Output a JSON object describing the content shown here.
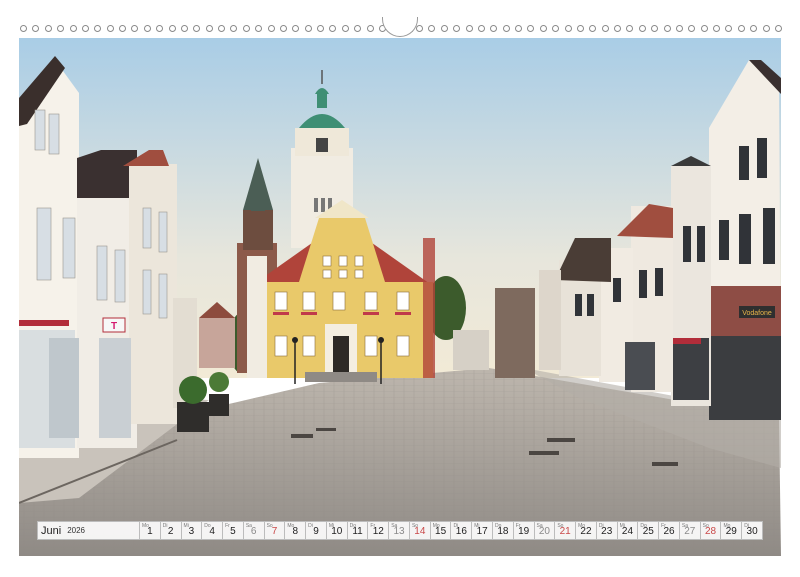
{
  "calendar": {
    "month": "Juni",
    "year": "2026",
    "days": [
      {
        "n": "1",
        "dow": "Mo",
        "t": "wd"
      },
      {
        "n": "2",
        "dow": "Di",
        "t": "wd"
      },
      {
        "n": "3",
        "dow": "Mi",
        "t": "wd"
      },
      {
        "n": "4",
        "dow": "Do",
        "t": "wd"
      },
      {
        "n": "5",
        "dow": "Fr",
        "t": "wd"
      },
      {
        "n": "6",
        "dow": "Sa",
        "t": "sat"
      },
      {
        "n": "7",
        "dow": "So",
        "t": "sun"
      },
      {
        "n": "8",
        "dow": "Mo",
        "t": "wd"
      },
      {
        "n": "9",
        "dow": "Di",
        "t": "wd"
      },
      {
        "n": "10",
        "dow": "Mi",
        "t": "wd"
      },
      {
        "n": "11",
        "dow": "Do",
        "t": "wd"
      },
      {
        "n": "12",
        "dow": "Fr",
        "t": "wd"
      },
      {
        "n": "13",
        "dow": "Sa",
        "t": "sat"
      },
      {
        "n": "14",
        "dow": "So",
        "t": "sun"
      },
      {
        "n": "15",
        "dow": "Mo",
        "t": "wd"
      },
      {
        "n": "16",
        "dow": "Di",
        "t": "wd"
      },
      {
        "n": "17",
        "dow": "Mi",
        "t": "wd"
      },
      {
        "n": "18",
        "dow": "Do",
        "t": "wd"
      },
      {
        "n": "19",
        "dow": "Fr",
        "t": "wd"
      },
      {
        "n": "20",
        "dow": "Sa",
        "t": "sat"
      },
      {
        "n": "21",
        "dow": "So",
        "t": "sun"
      },
      {
        "n": "22",
        "dow": "Mo",
        "t": "wd"
      },
      {
        "n": "23",
        "dow": "Di",
        "t": "wd"
      },
      {
        "n": "24",
        "dow": "Mi",
        "t": "wd"
      },
      {
        "n": "25",
        "dow": "Do",
        "t": "wd"
      },
      {
        "n": "26",
        "dow": "Fr",
        "t": "wd"
      },
      {
        "n": "27",
        "dow": "Sa",
        "t": "sat"
      },
      {
        "n": "28",
        "dow": "So",
        "t": "sun"
      },
      {
        "n": "29",
        "dow": "Mo",
        "t": "wd"
      },
      {
        "n": "30",
        "dow": "Di",
        "t": "wd"
      }
    ]
  },
  "signs": {
    "shop_left": "T",
    "shop_right": "Vodafone"
  },
  "colors": {
    "sky_top": "#a9cde6",
    "sky_bottom": "#f2ead6",
    "town_hall": "#e9c96a",
    "roof": "#b0443a",
    "tower": "#f1ece2",
    "copper": "#3f8f74",
    "pavement": "#a8a29a",
    "sunday": "#c94848"
  }
}
